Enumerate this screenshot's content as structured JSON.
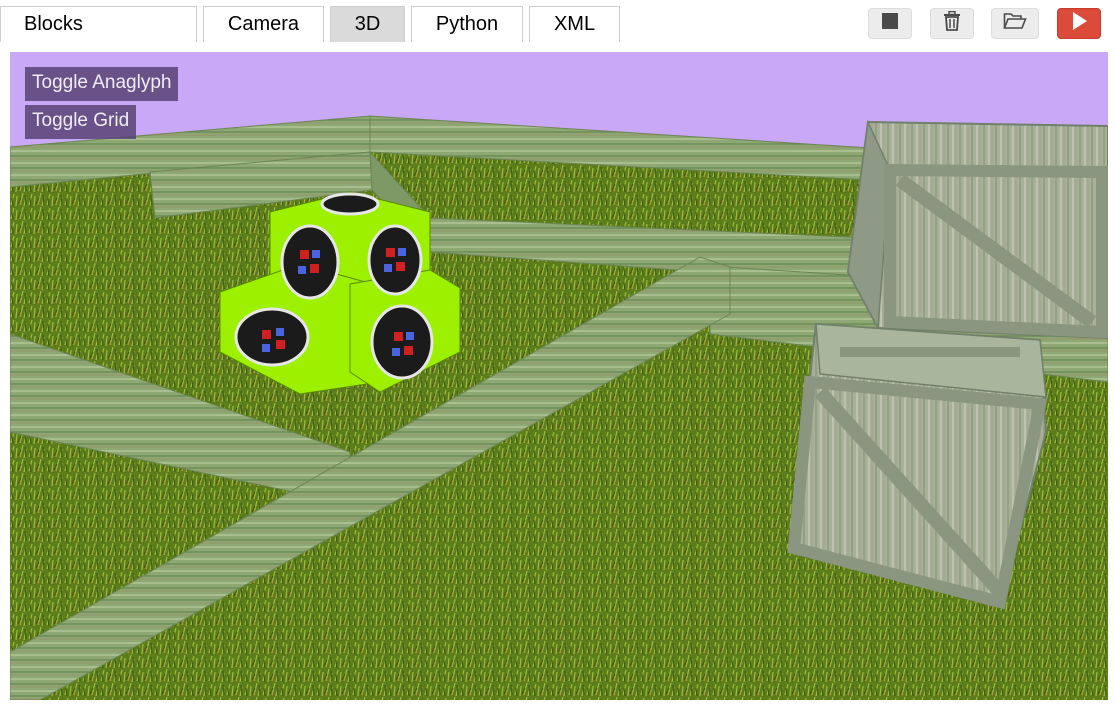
{
  "tabs": [
    {
      "label": "Blocks",
      "active": false
    },
    {
      "label": "Camera",
      "active": false
    },
    {
      "label": "3D",
      "active": true
    },
    {
      "label": "Python",
      "active": false
    },
    {
      "label": "XML",
      "active": false
    }
  ],
  "toolbar": {
    "stop_icon": "stop-square-icon",
    "delete_icon": "trash-icon",
    "open_icon": "folder-open-icon",
    "run_icon": "play-icon",
    "run_color": "#dc4a3a"
  },
  "scene": {
    "sky_color": "#c9a8f7",
    "ground_color": "#5f7f1f",
    "wall_color": "#8ea874",
    "crate_color": "#a9b49a",
    "cube_color": "#9cf000",
    "overlay_buttons": {
      "anaglyph": "Toggle Anaglyph",
      "grid": "Toggle Grid"
    }
  }
}
